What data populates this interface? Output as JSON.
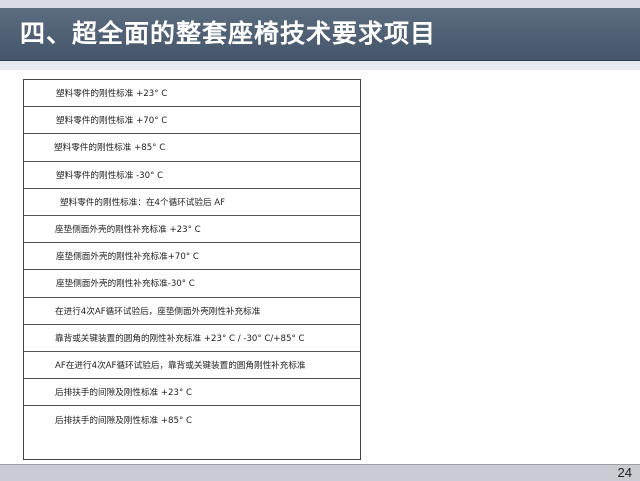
{
  "header": {
    "title": "四、超全面的整套座椅技术要求项目"
  },
  "requirements": [
    "塑料零件的刚性标准 +23° C",
    "塑料零件的刚性标准 +70° C",
    "塑料零件的刚性标准 +85° C",
    "塑料零件的刚性标准 -30° C",
    "塑料零件的刚性标准：在4个循环试验后 AF",
    "座垫侧面外壳的刚性补充标准 +23° C",
    "座垫侧面外壳的刚性补充标准+70° C",
    "座垫侧面外壳的刚性补充标准-30° C",
    "在进行4次AF循环试验后，座垫侧面外壳刚性补充标准",
    "靠背或关键装置的圆角的刚性补充标准 +23° C / -30° C/+85° C",
    "AF在进行4次AF循环试验后，靠背或关键装置的圆角刚性补充标准",
    "后排扶手的间隙及刚性标准 +23° C",
    "后排扶手的间隙及刚性标准 +85° C"
  ],
  "footer": {
    "page_number": "24"
  }
}
